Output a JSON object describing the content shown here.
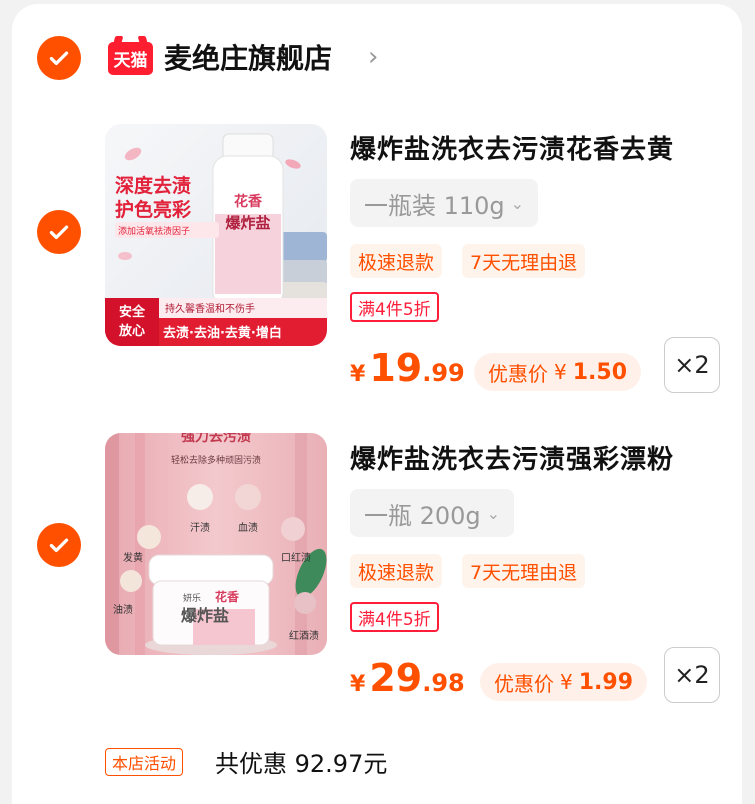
{
  "shop": {
    "badge": "天猫",
    "name": "麦绝庄旗舰店",
    "arrow_icon": "chevron-right-icon"
  },
  "items": [
    {
      "title": "爆炸盐洗衣去污渍花香去黄",
      "sku": "一瓶装 110g",
      "tags": [
        "极速退款",
        "7天无理由退"
      ],
      "promo": "满4件5折",
      "price_symbol": "¥",
      "price_int": "19",
      "price_dec": ".99",
      "deal_label": "优惠价",
      "deal_symbol": "¥",
      "deal_amount": "1.50",
      "qty": "×2",
      "image": {
        "headline1": "深度去渍",
        "headline2": "护色亮彩",
        "sub": "添加活氧祛渍因子",
        "bottle_brand": "花香",
        "bottle_name": "爆炸盐",
        "badge1": "安全",
        "badge2": "放心",
        "strip1": "持久馨香温和不伤手",
        "strip2": "去渍·去油·去黄·增白"
      }
    },
    {
      "title": "爆炸盐洗衣去污渍强彩漂粉",
      "sku": "一瓶 200g",
      "tags": [
        "极速退款",
        "7天无理由退"
      ],
      "promo": "满4件5折",
      "price_symbol": "¥",
      "price_int": "29",
      "price_dec": ".98",
      "deal_label": "优惠价",
      "deal_symbol": "¥",
      "deal_amount": "1.99",
      "qty": "×2",
      "image": {
        "top": "强力去污渍",
        "sub": "轻松去除多种顽固污渍",
        "labels": [
          "汗渍",
          "血渍",
          "发黄",
          "口红渍",
          "油渍",
          "红酒渍"
        ],
        "jar_brand": "花香",
        "jar_name": "爆炸盐",
        "jar_maker": "妍乐"
      }
    }
  ],
  "footer": {
    "activity_tag": "本店活动",
    "savings": "共优惠 92.97元"
  },
  "colors": {
    "accent": "#ff5000",
    "promo_red": "#ff1d3a",
    "tmall_red": "#ff1d30"
  }
}
